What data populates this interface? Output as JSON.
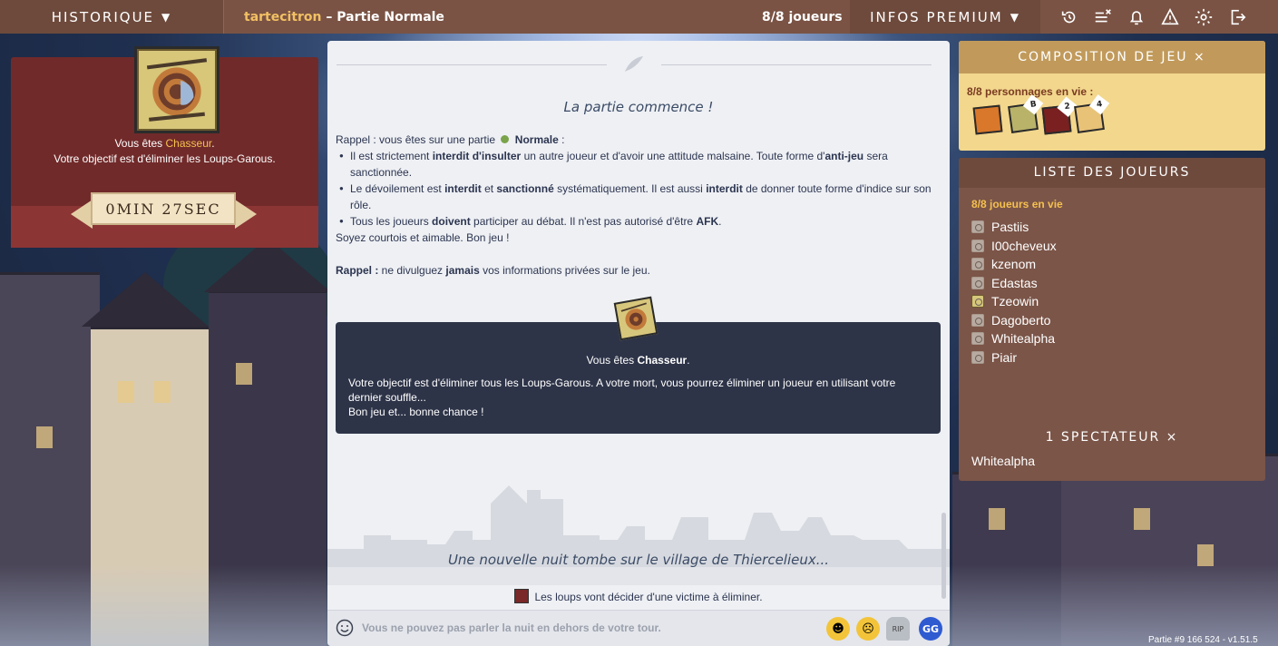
{
  "topbar": {
    "history_label": "HISTORIQUE",
    "host": "tartecitron",
    "game_separator": " – ",
    "game_mode": "Partie Normale",
    "player_count": "8/8 joueurs",
    "premium_label": "INFOS PREMIUM",
    "icons": [
      "refresh-icon",
      "clear-list-icon",
      "bell-icon",
      "warning-icon",
      "settings-icon",
      "exit-icon"
    ]
  },
  "role_card": {
    "you_are": "Vous êtes ",
    "role": "Chasseur",
    "period": ".",
    "objective": "Votre objectif est d'éliminer les Loups-Garous.",
    "timer": "0MIN 27SEC"
  },
  "chat": {
    "start_message": "La partie commence !",
    "rules": {
      "intro_prefix": "Rappel : vous êtes sur une partie",
      "mode": "Normale",
      "intro_suffix": " :",
      "items": [
        {
          "a": "Il est strictement ",
          "b": "interdit d'insulter",
          "c": " un autre joueur et d'avoir une attitude malsaine. Toute forme d'",
          "d": "anti-jeu",
          "e": " sera sanctionnée."
        },
        {
          "a": "Le dévoilement est ",
          "b": "interdit",
          "c": " et ",
          "d": "sanctionné",
          "e": " systématiquement. Il est aussi ",
          "f": "interdit",
          "g": " de donner toute forme d'indice sur son rôle."
        },
        {
          "a": "Tous les joueurs ",
          "b": "doivent",
          "c": " participer au débat. Il n'est pas autorisé d'être ",
          "d": "AFK",
          "e": "."
        }
      ],
      "closing": "Soyez courtois et aimable. Bon jeu !",
      "reminder_label": "Rappel :",
      "reminder_a": " ne divulguez ",
      "reminder_b": "jamais",
      "reminder_c": " vos informations privées sur le jeu."
    },
    "role_message": {
      "you_are": "Vous êtes ",
      "role": "Chasseur",
      "period": ".",
      "text": "Votre objectif est d'éliminer tous les Loups-Garous. A votre mort, vous pourrez éliminer un joueur en utilisant votre dernier souffle...",
      "closing": "Bon jeu et... bonne chance !"
    },
    "night_message": "Une nouvelle nuit tombe sur le village de Thiercelieux...",
    "wolves_message": "Les loups vont décider d'une victime à éliminer.",
    "input_placeholder": "Vous ne pouvez pas parler la nuit en dehors de votre tour.",
    "quick_emotes": [
      "happy-emote",
      "sad-emote",
      "rip-emote",
      "gg-emote"
    ],
    "rip_label": "RIP",
    "gg_label": "GG"
  },
  "composition": {
    "title": "COMPOSITION DE JEU ×",
    "alive_label": "8/8 personnages en vie :",
    "cards": [
      {
        "name": "role-card-1",
        "badge": "",
        "color": "#d9772a"
      },
      {
        "name": "role-card-hunter",
        "badge": "B",
        "color": "#b9b36a"
      },
      {
        "name": "role-card-wolf",
        "badge": "2",
        "color": "#7a2020"
      },
      {
        "name": "role-card-villager",
        "badge": "4",
        "color": "#e8c277"
      }
    ]
  },
  "players": {
    "title": "LISTE DES JOUEURS",
    "alive_label": "8/8 joueurs en vie",
    "list": [
      "Pastiis",
      "I00cheveux",
      "kzenom",
      "Edastas",
      "Tzeowin",
      "Dagoberto",
      "Whitealpha",
      "Piair"
    ],
    "spectator_title": "1 SPECTATEUR ×",
    "spectator": "Whitealpha"
  },
  "version": "Partie #9 166 524 - v1.51.5",
  "colors": {
    "topbar": "#7a5344",
    "role_card": "#712a2a",
    "accent_gold": "#f4c04f",
    "chat_bg": "#eef0f4",
    "role_box": "#2e3448",
    "composition_bg": "#f2d78d",
    "players_bg": "#7b5548"
  }
}
